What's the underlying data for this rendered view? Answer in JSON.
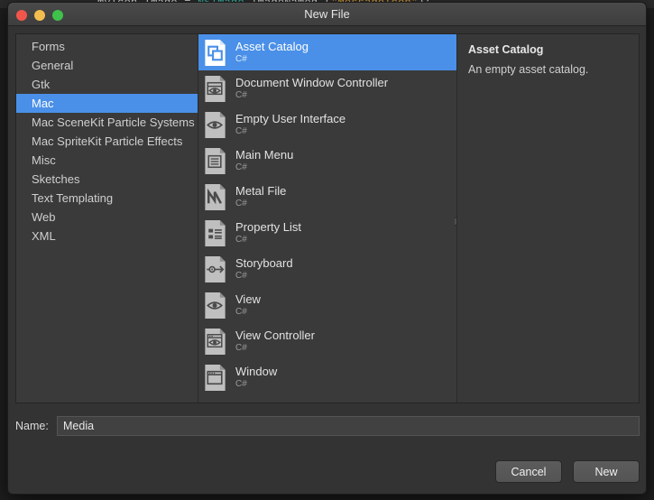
{
  "editor_background": {
    "code_segments": [
      {
        "text": "myIcon.Image = ",
        "kind": "plain"
      },
      {
        "text": "NSImage",
        "kind": "type"
      },
      {
        "text": ".ImageNamed (",
        "kind": "plain"
      },
      {
        "text": "\"MessageIcon\"",
        "kind": "string"
      },
      {
        "text": ");",
        "kind": "plain"
      }
    ]
  },
  "window": {
    "title": "New File",
    "traffic_lights": {
      "close": "close-button",
      "minimize": "minimize-button",
      "zoom": "zoom-button"
    },
    "colors": {
      "accent": "#4a90e8",
      "window_bg": "#333333",
      "pane_bg": "#3a3a3a",
      "titlebar": "#474747",
      "close": "#f2564b",
      "minimize": "#f4bd4f",
      "zoom": "#3fc14c"
    }
  },
  "categories": {
    "selected": "Mac",
    "items": [
      {
        "label": "Forms",
        "selected": false
      },
      {
        "label": "General",
        "selected": false
      },
      {
        "label": "Gtk",
        "selected": false
      },
      {
        "label": "Mac",
        "selected": true
      },
      {
        "label": "Mac SceneKit Particle Systems",
        "selected": false
      },
      {
        "label": "Mac SpriteKit Particle Effects",
        "selected": false
      },
      {
        "label": "Misc",
        "selected": false
      },
      {
        "label": "Sketches",
        "selected": false
      },
      {
        "label": "Text Templating",
        "selected": false
      },
      {
        "label": "Web",
        "selected": false
      },
      {
        "label": "XML",
        "selected": false
      }
    ]
  },
  "templates": {
    "selected": "Asset Catalog",
    "items": [
      {
        "title": "Asset Catalog",
        "language": "C#",
        "icon": "asset-catalog-icon",
        "selected": true
      },
      {
        "title": "Document Window Controller",
        "language": "C#",
        "icon": "document-window-controller-icon",
        "selected": false
      },
      {
        "title": "Empty User Interface",
        "language": "C#",
        "icon": "empty-user-interface-icon",
        "selected": false
      },
      {
        "title": "Main Menu",
        "language": "C#",
        "icon": "main-menu-icon",
        "selected": false
      },
      {
        "title": "Metal File",
        "language": "C#",
        "icon": "metal-file-icon",
        "selected": false
      },
      {
        "title": "Property List",
        "language": "C#",
        "icon": "property-list-icon",
        "selected": false
      },
      {
        "title": "Storyboard",
        "language": "C#",
        "icon": "storyboard-icon",
        "selected": false
      },
      {
        "title": "View",
        "language": "C#",
        "icon": "view-icon",
        "selected": false
      },
      {
        "title": "View Controller",
        "language": "C#",
        "icon": "view-controller-icon",
        "selected": false
      },
      {
        "title": "Window",
        "language": "C#",
        "icon": "window-icon",
        "selected": false
      }
    ]
  },
  "detail": {
    "title": "Asset Catalog",
    "description": "An empty asset catalog."
  },
  "name_field": {
    "label": "Name:",
    "value": "Media",
    "placeholder": ""
  },
  "actions": {
    "cancel_label": "Cancel",
    "new_label": "New"
  }
}
